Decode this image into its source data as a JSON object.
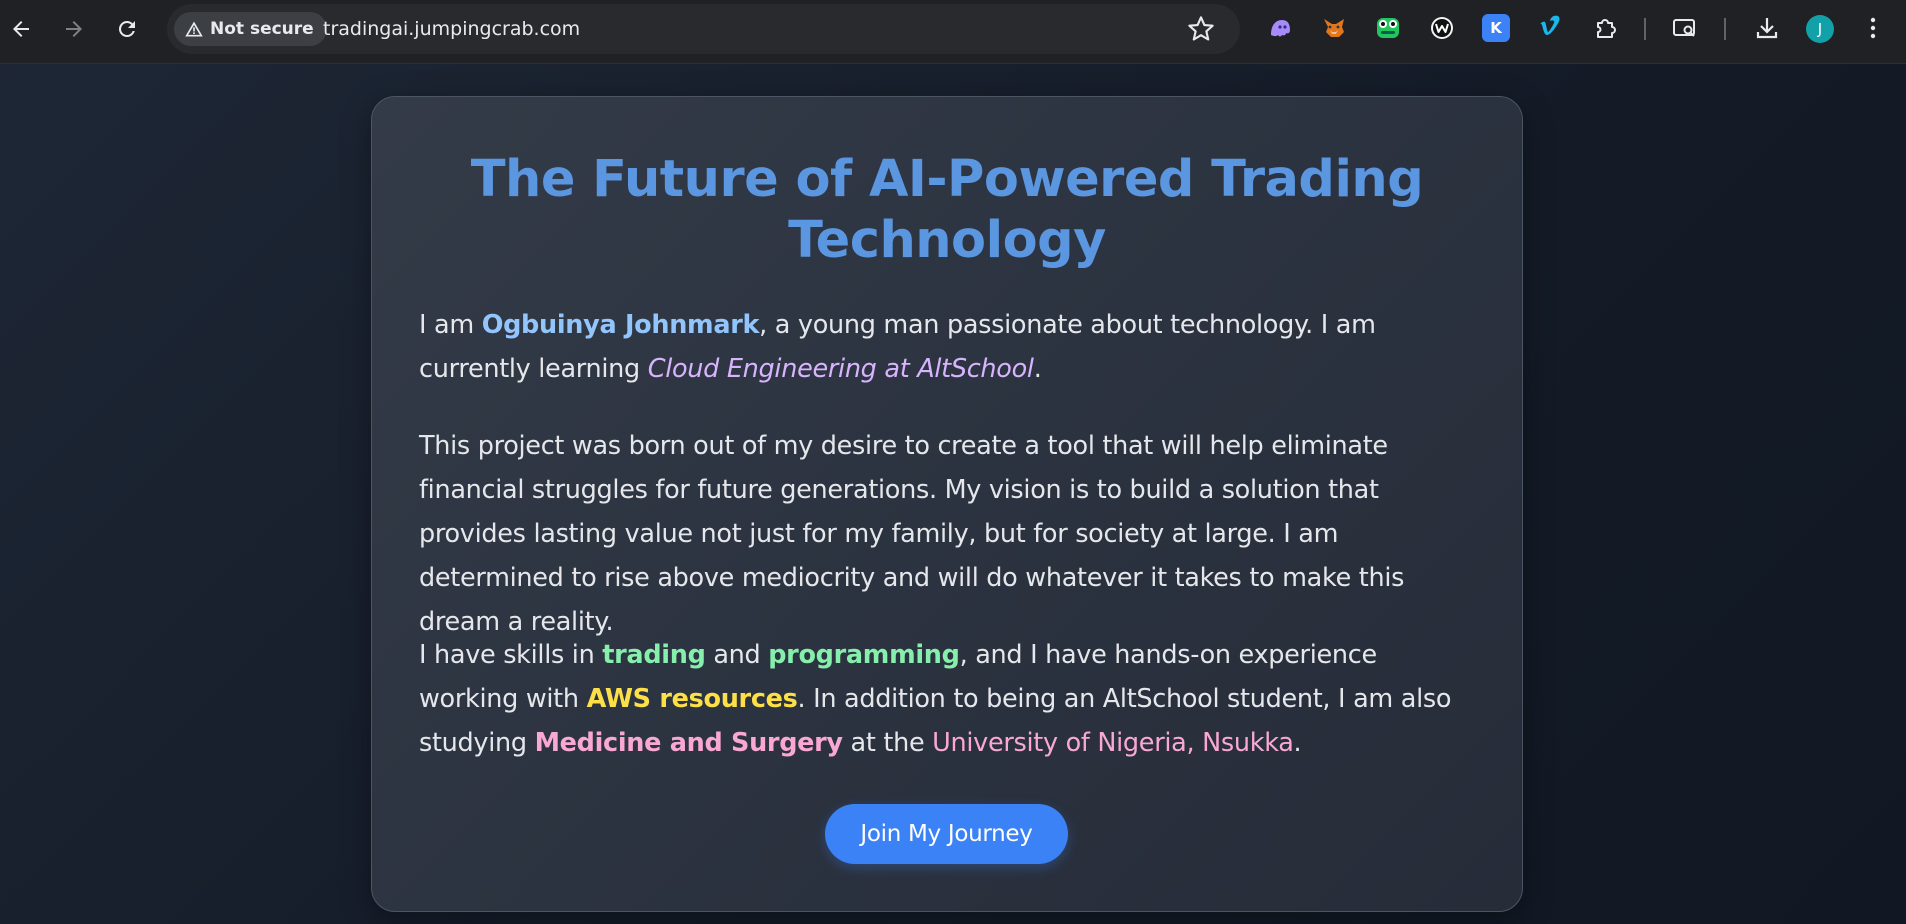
{
  "browser": {
    "security_label": "Not secure",
    "url": "tradingai.jumpingcrab.com",
    "avatar_initial": "J",
    "extensions": [
      "ghost-extension-icon",
      "metamask-fox-icon",
      "frog-extension-icon",
      "w-extension-icon",
      "k-extension-icon",
      "vimeo-icon",
      "puzzle-extensions-icon"
    ],
    "ext_k_label": "K"
  },
  "page": {
    "title": "The Future of AI-Powered Trading Technology",
    "p1": {
      "t1": "I am ",
      "name": "Ogbuinya Johnmark",
      "t2": ", a young man passionate about technology. I am currently learning ",
      "course": "Cloud Engineering at AltSchool",
      "t3": "."
    },
    "p2": "This project was born out of my desire to create a tool that will help eliminate financial struggles for future generations. My vision is to build a solution that provides lasting value not just for my family, but for society at large. I am determined to rise above mediocrity and will do whatever it takes to make this dream a reality.",
    "p3": {
      "t1": "I have skills in ",
      "skill1": "trading",
      "t2": " and ",
      "skill2": "programming",
      "t3": ", and I have hands-on experience working with ",
      "aws": "AWS resources",
      "t4": ". In addition to being an AltSchool student, I am also studying ",
      "medicine": "Medicine and Surgery",
      "t5": " at the ",
      "university": "University of Nigeria, Nsukka",
      "t6": "."
    },
    "cta_label": "Join My Journey"
  },
  "colors": {
    "title": "#5b96e0",
    "name": "#93c5fd",
    "course": "#d8b4fe",
    "skills": "#86efac",
    "aws": "#fde047",
    "medicine": "#f9a8d4",
    "cta": "#3b82f6"
  }
}
